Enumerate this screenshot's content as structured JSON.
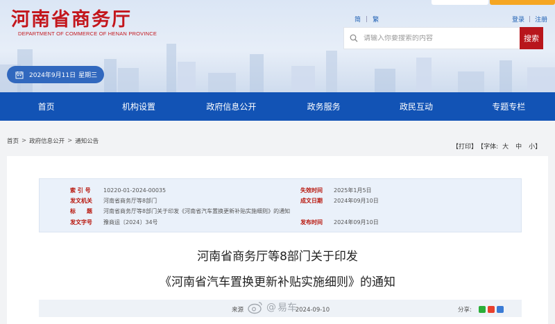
{
  "header": {
    "site_title": "河南省商务厅",
    "site_subtitle": "DEPARTMENT OF COMMERCE OF HENAN PROVINCE",
    "lang": {
      "simplified": "简",
      "traditional": "繁"
    },
    "auth": {
      "login": "登录",
      "register": "注册"
    },
    "search": {
      "placeholder": "请输入你要搜索的内容",
      "button": "搜索"
    },
    "date": {
      "date": "2024年9月11日",
      "weekday": "星期三"
    }
  },
  "nav": {
    "items": [
      "首页",
      "机构设置",
      "政府信息公开",
      "政务服务",
      "政民互动",
      "专题专栏"
    ]
  },
  "breadcrumb": {
    "items": [
      "首页",
      "政府信息公开",
      "通知公告"
    ],
    "separator": ">"
  },
  "tools": {
    "print": "打印",
    "font_label": "字体:",
    "large": "大",
    "medium": "中",
    "small": "小"
  },
  "meta": {
    "index_label": "索 引 号",
    "index_value": "10220-01-2024-00035",
    "invalid_label": "失效时间",
    "invalid_value": "2025年1月5日",
    "issuer_label": "发文机关",
    "issuer_value": "河南省商务厅等8部门",
    "created_label": "成文日期",
    "created_value": "2024年09月10日",
    "title_label": "标　　题",
    "title_value": "河南省商务厅等8部门关于印发《河南省汽车置换更新补贴实施细则》的通知",
    "docno_label": "发文字号",
    "docno_value": "豫商运〔2024〕34号",
    "published_label": "发布时间",
    "published_value": "2024年09月10日"
  },
  "document": {
    "title_line1": "河南省商务厅等8部门关于印发",
    "title_line2": "《河南省汽车置换更新补贴实施细则》的通知"
  },
  "info_bar": {
    "source_prefix": "来源",
    "date": "2024-09-10",
    "share_label": "分享:"
  },
  "watermark": {
    "text": "易车"
  },
  "colors": {
    "brand_red": "#c3161c",
    "nav_blue": "#1253b5",
    "date_pill": "#3168be",
    "search_button": "#b8161c"
  }
}
